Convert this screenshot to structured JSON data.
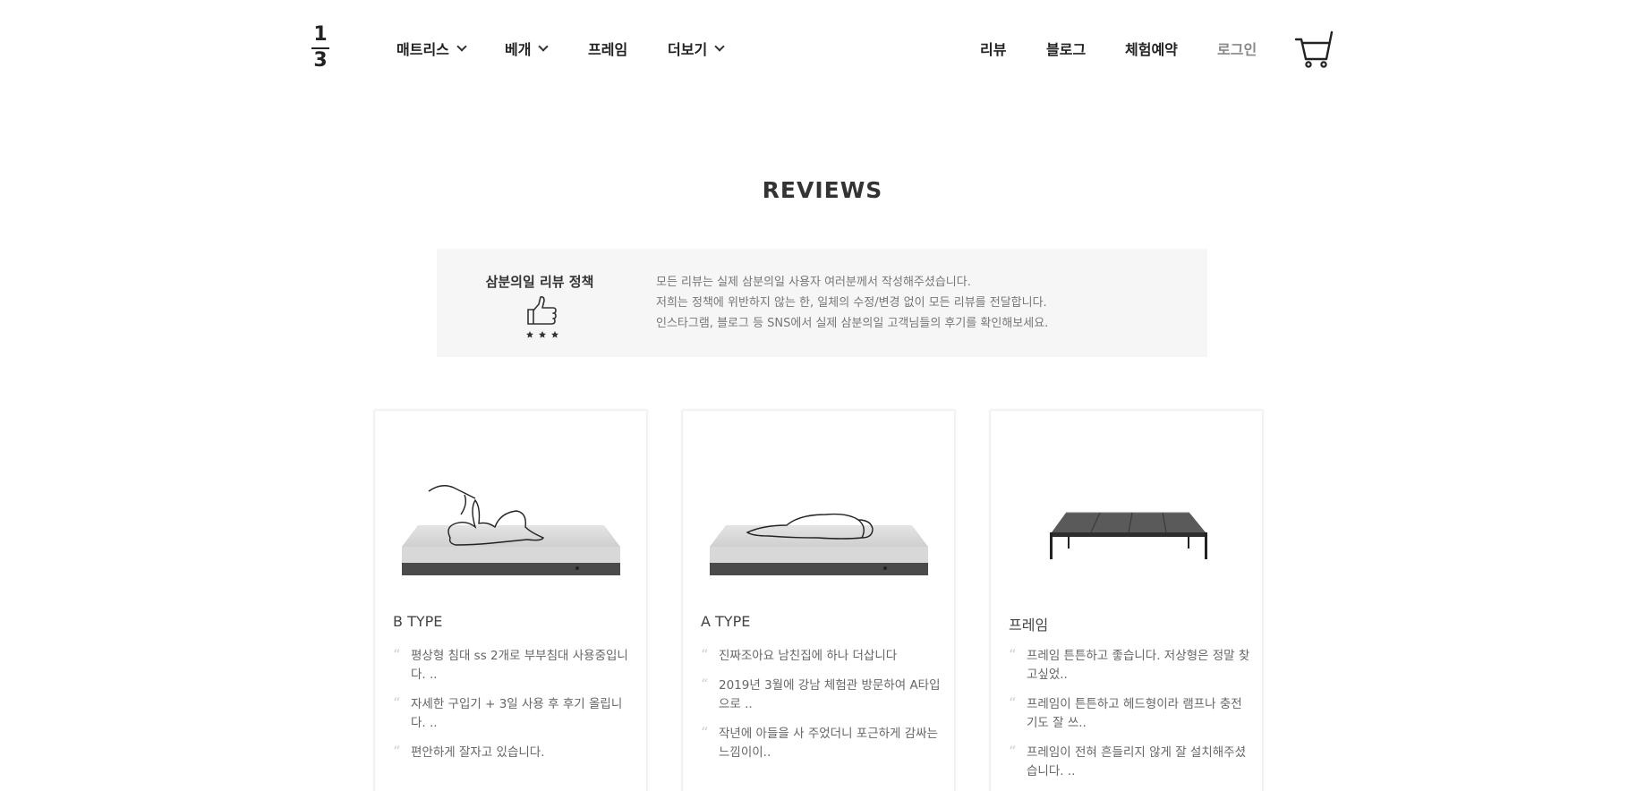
{
  "logo": {
    "top": "1",
    "bottom": "3"
  },
  "nav": {
    "left": [
      {
        "label": "매트리스",
        "has_dropdown": true
      },
      {
        "label": "베개",
        "has_dropdown": true
      },
      {
        "label": "프레임",
        "has_dropdown": false
      },
      {
        "label": "더보기",
        "has_dropdown": true
      }
    ],
    "right": [
      {
        "label": "리뷰"
      },
      {
        "label": "블로그"
      },
      {
        "label": "체험예약"
      },
      {
        "label": "로그인"
      }
    ],
    "cart_icon": "shopping-cart-icon"
  },
  "page": {
    "title": "REVIEWS"
  },
  "policy": {
    "title": "삼분의일 리뷰 정책",
    "icon": "thumbs-up-icon",
    "lines": [
      "모든 리뷰는 실제 삼분의일 사용자 여러분께서 작성해주셨습니다.",
      "저희는 정책에 위반하지 않는 한, 일체의 수정/변경 없이 모든 리뷰를 전달합니다.",
      "인스타그램, 블로그 등 SNS에서 실제 삼분의일 고객님들의 후기를 확인해보세요."
    ]
  },
  "cards": [
    {
      "title": "B TYPE",
      "image": "mattress-person-lying-image",
      "reviews": [
        "평상형 침대 ss 2개로 부부침대 사용중입니다. ..",
        "자세한 구입기 + 3일 사용 후 후기 올립니다. ..",
        "편안하게 잘자고 있습니다."
      ]
    },
    {
      "title": "A TYPE",
      "image": "mattress-person-sleeping-image",
      "reviews": [
        "진짜조아요 남친집에 하나 더삽니다",
        "2019년 3월에 강남 체험관 방문하여 A타입으로 ..",
        "작년에 아들을 사 주었더니 포근하게 감싸는 느낌이이.."
      ]
    },
    {
      "title": "프레임",
      "image": "bed-frame-image",
      "reviews": [
        "프레임 튼튼하고 좋습니다. 저상형은 정말 찾고싶었..",
        "프레임이 튼튼하고 헤드형이라 램프나 충전기도 잘 쓰..",
        "프레임이 전혀 흔들리지 않게 잘 설치해주셨습니다. .."
      ]
    }
  ],
  "colors": {
    "text": "#333333",
    "policy_bg": "#f6f6f6",
    "muted": "#888888"
  }
}
